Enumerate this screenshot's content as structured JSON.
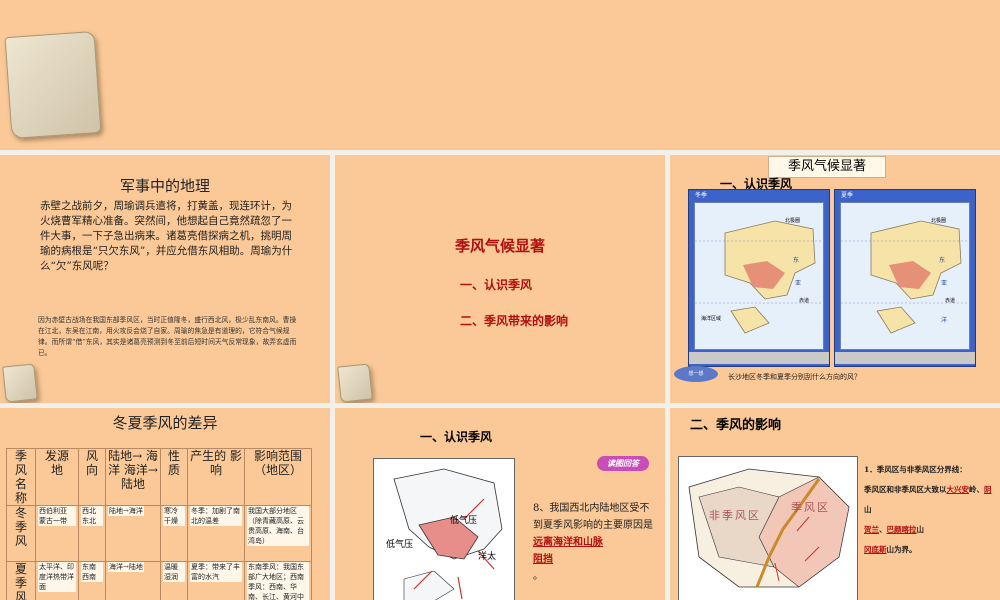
{
  "slides": {
    "s1": {},
    "s2": {
      "title": "军事中的地理",
      "body": "赤壁之战前夕，周瑜调兵遣将，打黄盖，现连环计，为火烧曹军精心准备。突然间，他想起自己竟然疏忽了一件大事，一下子急出病来。诸葛亮借探病之机，挑明周瑜的病根是“只欠东风”，并应允借东风相助。周瑜为什么“欠”东风呢？",
      "answer": "因为赤壁古战场在我国东部季风区，当时正值隆冬，盛行西北风，极少乱东南风。曹操在江北，东吴在江南，用火攻反会烧了自家。周瑜的焦急是有道理的，它符合气候规律。而所谓“借”东风，其实是诸葛亮预测到冬至前后短时间天气反常现象，故弄玄虚而已。"
    },
    "s3": {
      "title": "季风气候显著",
      "item1": "一、认识季风",
      "item2": "二、季风带来的影响"
    },
    "s4": {
      "tag": "季风气候显著",
      "heading": "一、认识季风",
      "map_left": {
        "label": "冬季",
        "n1": "北极圈",
        "n2": "东",
        "n3": "亚",
        "n4": "赤道",
        "n5": "海洋区域"
      },
      "map_right": {
        "label": "夏季",
        "n1": "北极圈",
        "n2": "东",
        "n3": "亚",
        "n4": "赤道",
        "n5": "洋"
      },
      "bubble": "想一想",
      "question": "长沙地区冬季和夏季分别刮什么方向的风？"
    },
    "s5": {
      "title": "冬夏季风的差异",
      "headers": [
        "季风名称",
        "发源地",
        "风向",
        "陆地→海洋",
        "性质",
        "产生的影响",
        "影响范围（地区）"
      ],
      "headers_cells": {
        "name": "季 风 名 称",
        "source": "发源 地",
        "dir": "风 向",
        "land": "陆地→ 海洋 海洋→ 陆地",
        "nature": "性 质",
        "effect": "产生的 影响",
        "range": "影响范围（地区）"
      },
      "winter": {
        "name": "冬 季 风",
        "source": "西伯利亚 蒙古一带",
        "dir": "西北 东北",
        "land": "陆地→海洋",
        "nature": "寒冷 干燥",
        "effect": "冬季：加剧了南北的温差",
        "range": "我国大部分地区（除青藏高原、云贵高原、海南、台湾岛）"
      },
      "summer": {
        "name": "夏 季 风",
        "source": "太平洋、印度洋热带洋面",
        "dir": "东南 西南",
        "land": "海洋→陆地",
        "nature": "温暖 湿润",
        "effect": "夏季：带来了丰富的水汽",
        "range": "东南季风：我国东部广大地区；西南季风：西南、华南、长江、黄河中下游地区"
      }
    },
    "s6": {
      "heading": "一、认识季风",
      "btn": "读图回答",
      "low1": "低气压",
      "low2": "低气压",
      "ocean": "洋太",
      "q_prefix": "8、我国西北内陆地区受不到夏季风影响的主要原因是",
      "answer1": "远离海洋和山脉",
      "answer2": "阻挡",
      "end": "。"
    },
    "s7": {
      "heading": "二、季风的影响",
      "t1": "1．季风区与非季风区分界线：",
      "t2": "季风区和非季风区大致以",
      "a1": "大兴安",
      "t3": "岭、",
      "a2": "阴",
      "t4": "山",
      "a3": "贺兰",
      "t5": "、",
      "a4": "巴颜喀拉",
      "t6": "山",
      "a5": "冈底斯",
      "t7": "山为界。",
      "map_text1": "非季风区",
      "map_text2": "季风区"
    }
  }
}
